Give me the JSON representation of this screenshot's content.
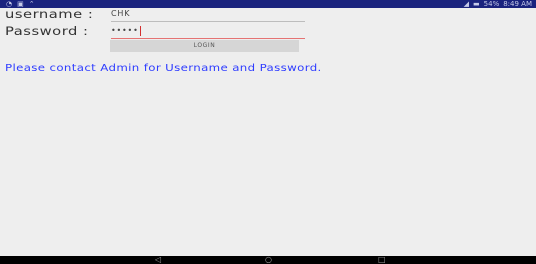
{
  "status_bar": {
    "battery": "54%",
    "time": "8:49 AM"
  },
  "form": {
    "username_label": "username :",
    "username_value": "CHK",
    "password_label": "Password :",
    "password_value": "•••••",
    "login_label": "LOGIN"
  },
  "message": "Please contact Admin for Username and Password."
}
